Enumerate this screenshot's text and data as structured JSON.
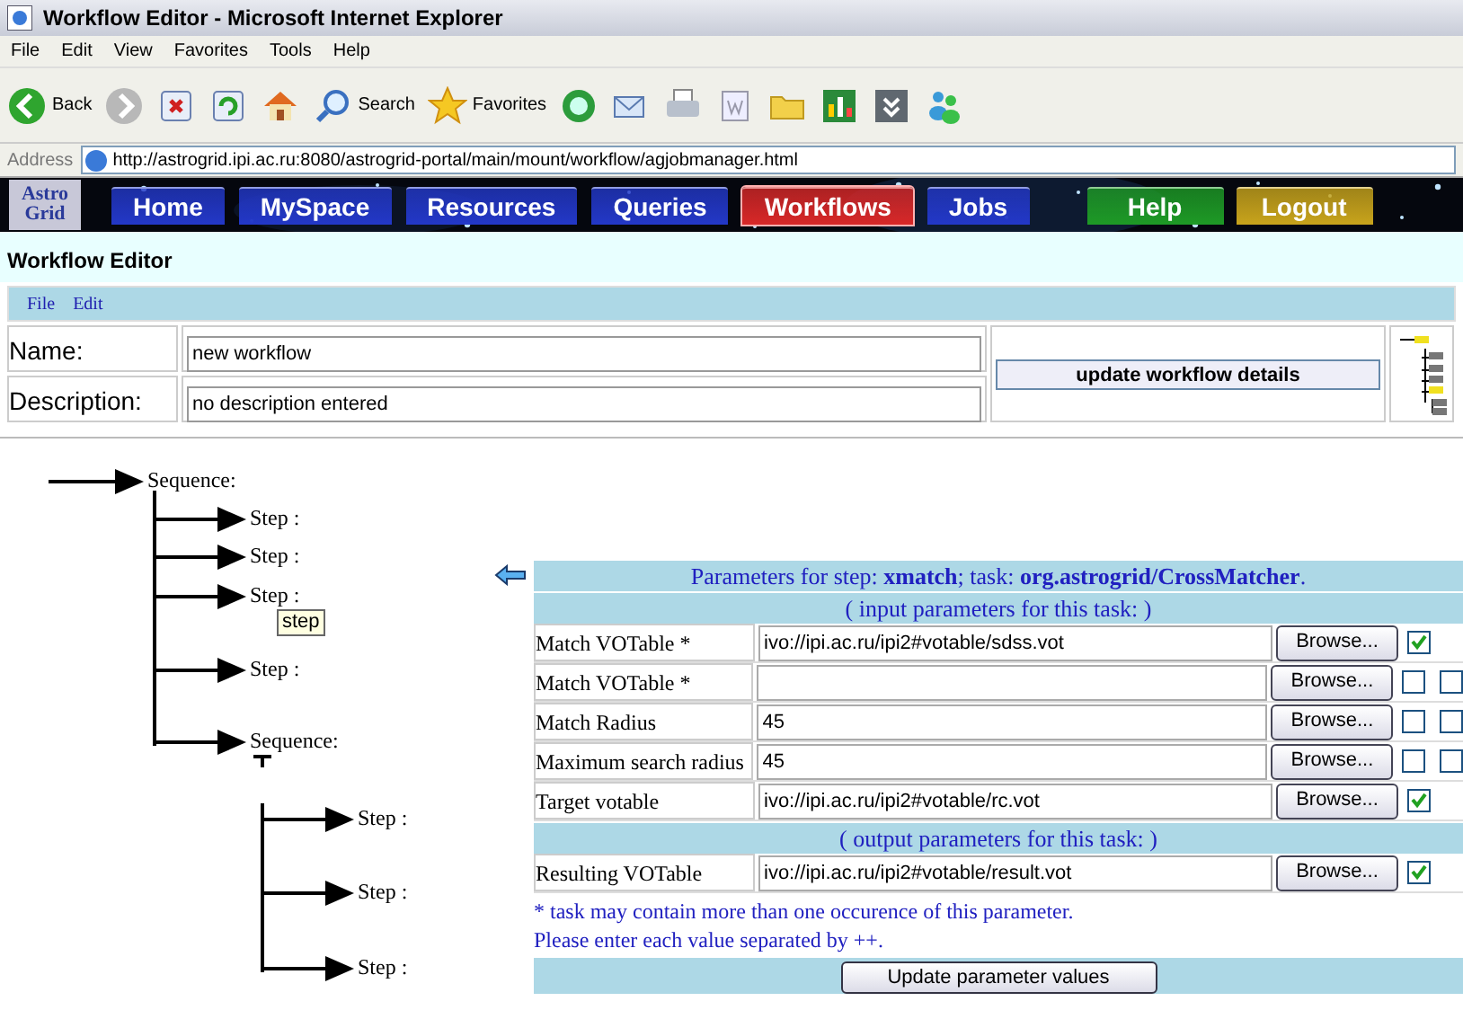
{
  "window": {
    "title": "Workflow Editor - Microsoft Internet Explorer"
  },
  "menu": [
    "File",
    "Edit",
    "View",
    "Favorites",
    "Tools",
    "Help"
  ],
  "toolbar": [
    {
      "kind": "back",
      "label": "Back"
    },
    {
      "kind": "forward"
    },
    {
      "kind": "stop"
    },
    {
      "kind": "refresh"
    },
    {
      "kind": "home"
    },
    {
      "kind": "search",
      "label": "Search"
    },
    {
      "kind": "favorites",
      "label": "Favorites"
    },
    {
      "kind": "media"
    },
    {
      "kind": "mail"
    },
    {
      "kind": "print"
    },
    {
      "kind": "word"
    },
    {
      "kind": "folder"
    },
    {
      "kind": "chart"
    },
    {
      "kind": "tool"
    },
    {
      "kind": "messenger"
    }
  ],
  "address": {
    "label": "Address",
    "url": "http://astrogrid.ipi.ac.ru:8080/astrogrid-portal/main/mount/workflow/agjobmanager.html"
  },
  "banner": {
    "logo": [
      "Astro",
      "Grid"
    ],
    "nav": [
      {
        "label": "Home",
        "color": "#2338c8",
        "selected": false
      },
      {
        "label": "MySpace",
        "color": "#2338c8",
        "selected": false
      },
      {
        "label": "Resources",
        "color": "#2338c8",
        "selected": false
      },
      {
        "label": "Queries",
        "color": "#2338c8",
        "selected": false
      },
      {
        "label": "Workflows",
        "color": "#d82828",
        "selected": true
      },
      {
        "label": "Jobs",
        "color": "#2338c8",
        "selected": false
      },
      {
        "label": "Help",
        "color": "#1e9a26",
        "selected": false
      },
      {
        "label": "Logout",
        "color": "#c8a41c",
        "selected": false
      }
    ]
  },
  "page_title": "Workflow Editor",
  "editor_menu": [
    "File",
    "Edit"
  ],
  "details": {
    "name_label": "Name:",
    "name": "new workflow",
    "description_label": "Description:",
    "description": "no description entered",
    "update_button": "update workflow details"
  },
  "tree": {
    "kind": "sequence",
    "label": "Sequence:",
    "children": [
      {
        "kind": "step",
        "label": "Step :"
      },
      {
        "kind": "step",
        "label": "Step :"
      },
      {
        "kind": "step",
        "label": "Step :",
        "tooltip": "step"
      },
      {
        "kind": "step",
        "label": "Step :"
      },
      {
        "kind": "sequence",
        "label": "Sequence:",
        "children": [
          {
            "kind": "step",
            "label": "Step :"
          },
          {
            "kind": "step",
            "label": "Step :"
          },
          {
            "kind": "step",
            "label": "Step :"
          }
        ]
      }
    ]
  },
  "parameters": {
    "title": "Parameters for step: **xmatch**; task: **org.astrogrid/CrossMatcher**.",
    "rows": [
      {
        "kind": "header",
        "label": "( input parameters for this task: )"
      },
      {
        "kind": "param",
        "label": "Match VOTable *",
        "value": "ivo://ipi.ac.ru/ipi2#votable/sdss.vot",
        "button": "Browse...",
        "checkboxes": [
          {
            "checked": true
          }
        ]
      },
      {
        "kind": "param",
        "label": "Match VOTable *",
        "value": "",
        "button": "Browse...",
        "checkboxes": [
          {
            "checked": false
          },
          {
            "checked": false
          }
        ]
      },
      {
        "kind": "param",
        "label": "Match Radius",
        "value": "45",
        "button": "Browse...",
        "checkboxes": [
          {
            "checked": false
          },
          {
            "checked": false
          }
        ]
      },
      {
        "kind": "param",
        "label": "Maximum search radius",
        "value": "45",
        "button": "Browse...",
        "checkboxes": [
          {
            "checked": false
          },
          {
            "checked": false
          }
        ]
      },
      {
        "kind": "param",
        "label": "Target votable",
        "value": "ivo://ipi.ac.ru/ipi2#votable/rc.vot",
        "button": "Browse...",
        "checkboxes": [
          {
            "checked": true
          }
        ]
      },
      {
        "kind": "header",
        "label": "( output parameters for this task: )"
      },
      {
        "kind": "param",
        "label": "Resulting VOTable",
        "value": "ivo://ipi.ac.ru/ipi2#votable/result.vot",
        "button": "Browse...",
        "checkboxes": [
          {
            "checked": true
          }
        ]
      }
    ],
    "notes": [
      "* task may contain more than one occurence of this parameter.",
      "Please enter each value separated by ++."
    ],
    "update_button": "Update parameter values"
  }
}
